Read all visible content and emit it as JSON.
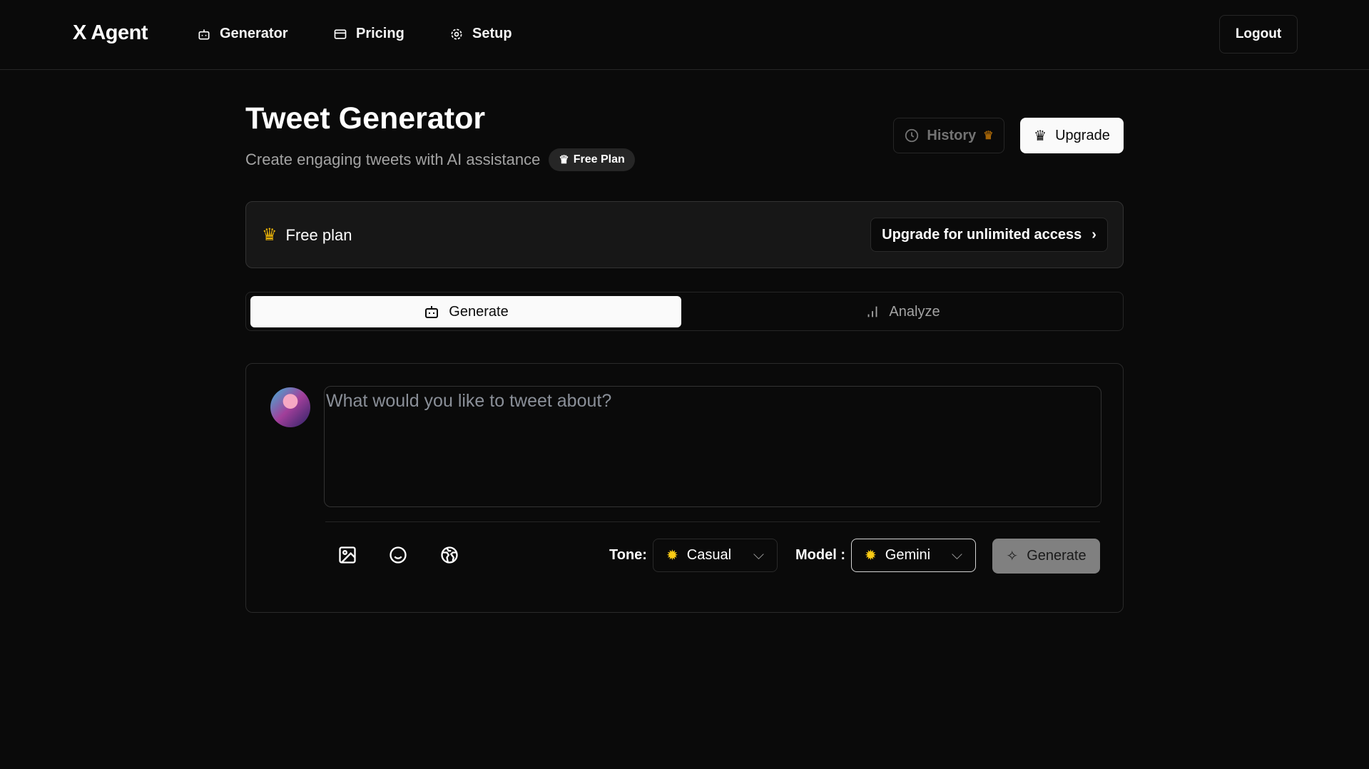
{
  "nav": {
    "logo": "X Agent",
    "links": [
      {
        "label": "Generator",
        "icon": "bot-icon"
      },
      {
        "label": "Pricing",
        "icon": "card-icon"
      },
      {
        "label": "Setup",
        "icon": "gear-icon"
      }
    ],
    "logout": "Logout"
  },
  "header": {
    "title": "Tweet Generator",
    "subtitle": "Create engaging tweets with AI assistance",
    "badge": "Free Plan",
    "history": "History",
    "upgrade": "Upgrade"
  },
  "plan": {
    "label": "Free plan",
    "cta": "Upgrade for unlimited access"
  },
  "tabs": [
    {
      "label": "Generate",
      "active": true
    },
    {
      "label": "Analyze",
      "active": false
    }
  ],
  "composer": {
    "placeholder": "What would you like to tweet about?",
    "value": "",
    "tone_label": "Tone:",
    "tone": "Casual",
    "model_label": "Model :",
    "model": "Gemini",
    "generate": "Generate"
  },
  "colors": {
    "accent_gold": "#eab308",
    "background": "#0a0a0a"
  }
}
